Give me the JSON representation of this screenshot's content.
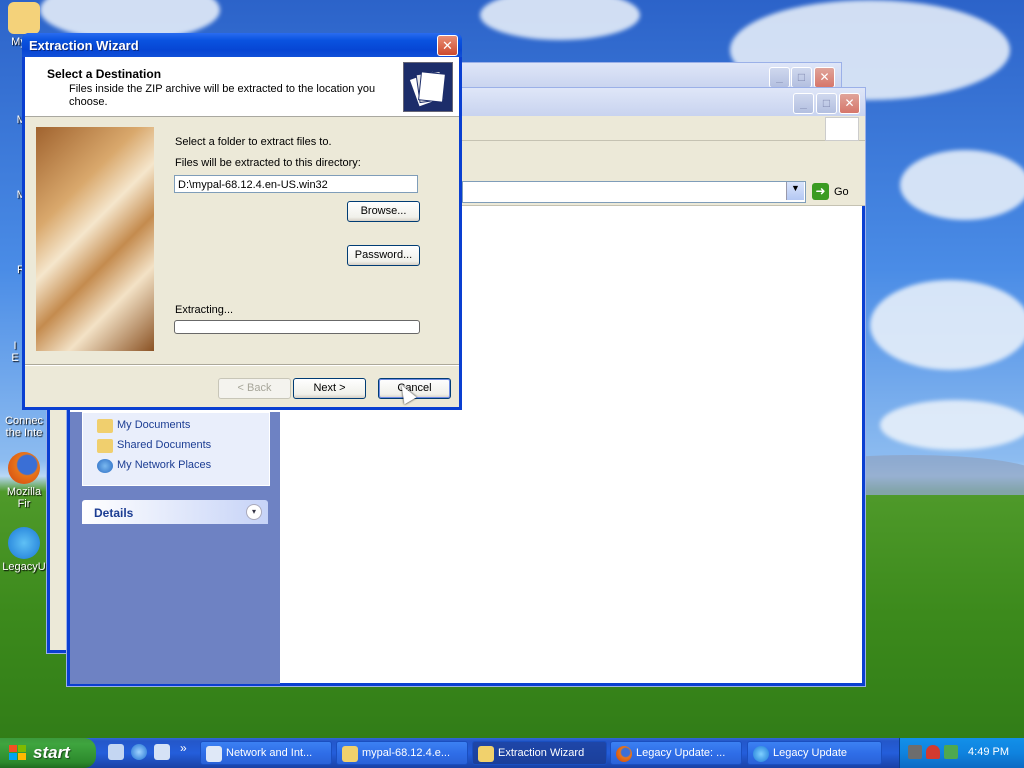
{
  "desktop": {
    "icons": [
      {
        "label": "My D"
      },
      {
        "label": "My"
      },
      {
        "label": "My"
      },
      {
        "label": "Re"
      },
      {
        "label": "I\nE"
      },
      {
        "label": "Connec\nthe Inte"
      },
      {
        "label": "Mozilla Fir"
      },
      {
        "label": "LegacyU"
      }
    ]
  },
  "explorer": {
    "tasks": [
      "My Documents",
      "Shared Documents",
      "My Network Places"
    ],
    "details_label": "Details",
    "go_label": "Go"
  },
  "dialog": {
    "title": "Extraction Wizard",
    "header_title": "Select a Destination",
    "header_subtitle": "Files inside the ZIP archive will be extracted to the location you choose.",
    "select_folder_label": "Select a folder to extract files to.",
    "directory_label": "Files will be extracted to this directory:",
    "directory_value": "D:\\mypal-68.12.4.en-US.win32",
    "browse_button": "Browse...",
    "password_button": "Password...",
    "extracting_label": "Extracting...",
    "progress": 0,
    "back_button": "< Back",
    "next_button": "Next >",
    "cancel_button": "Cancel"
  },
  "taskbar": {
    "start_label": "start",
    "items": [
      {
        "label": "Network and Int...",
        "icon": "folder-network-icon"
      },
      {
        "label": "mypal-68.12.4.e...",
        "icon": "zip-folder-icon"
      },
      {
        "label": "Extraction Wizard",
        "icon": "folder-icon",
        "active": true
      },
      {
        "label": "Legacy Update: ...",
        "icon": "firefox-icon"
      },
      {
        "label": "Legacy Update",
        "icon": "legacy-update-icon"
      }
    ],
    "clock": "4:49 PM"
  }
}
